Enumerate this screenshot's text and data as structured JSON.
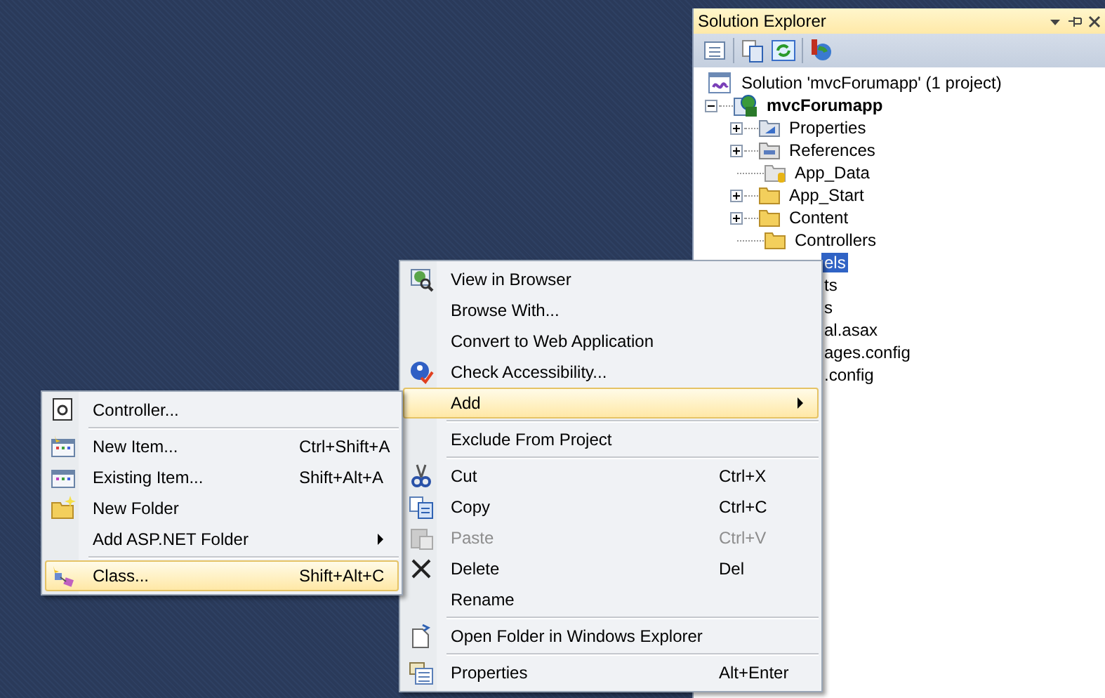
{
  "solution_explorer": {
    "title": "Solution Explorer",
    "tree": [
      {
        "label": "Solution 'mvcForumapp' (1 project)",
        "kind": "solution",
        "selected": false,
        "children": [
          {
            "label": "mvcForumapp",
            "kind": "project",
            "expanded": true,
            "selected": false,
            "children": [
              {
                "label": "Properties",
                "kind": "properties",
                "expanded": false,
                "selected": false
              },
              {
                "label": "References",
                "kind": "references",
                "expanded": false,
                "selected": false
              },
              {
                "label": "App_Data",
                "kind": "datafolder",
                "selected": false
              },
              {
                "label": "App_Start",
                "kind": "folder",
                "expanded": false,
                "selected": false
              },
              {
                "label": "Content",
                "kind": "folder",
                "expanded": false,
                "selected": false
              },
              {
                "label": "Controllers",
                "kind": "folder",
                "selected": false
              },
              {
                "label": "els",
                "kind": "cut",
                "selected": true
              },
              {
                "label": "ts",
                "kind": "cut",
                "selected": false
              },
              {
                "label": "s",
                "kind": "cut",
                "selected": false
              },
              {
                "label": "al.asax",
                "kind": "cut",
                "selected": false
              },
              {
                "label": "ages.config",
                "kind": "cut",
                "selected": false
              },
              {
                "label": ".config",
                "kind": "cut",
                "selected": false
              }
            ]
          }
        ]
      }
    ]
  },
  "context_menu": {
    "items": [
      {
        "kind": "item",
        "label": "View in Browser",
        "selected": false,
        "disabled": false
      },
      {
        "kind": "item",
        "label": "Browse With...",
        "selected": false,
        "disabled": false
      },
      {
        "kind": "item",
        "label": "Convert to Web Application",
        "selected": false,
        "disabled": false
      },
      {
        "kind": "item",
        "label": "Check Accessibility...",
        "selected": false,
        "disabled": false
      },
      {
        "kind": "submenu",
        "label": "Add",
        "selected": true,
        "disabled": false
      },
      {
        "kind": "separator"
      },
      {
        "kind": "item",
        "label": "Exclude From Project",
        "selected": false,
        "disabled": false
      },
      {
        "kind": "separator"
      },
      {
        "kind": "item",
        "label": "Cut",
        "shortcut": "Ctrl+X",
        "selected": false,
        "disabled": false
      },
      {
        "kind": "item",
        "label": "Copy",
        "shortcut": "Ctrl+C",
        "selected": false,
        "disabled": false
      },
      {
        "kind": "item",
        "label": "Paste",
        "shortcut": "Ctrl+V",
        "selected": false,
        "disabled": true
      },
      {
        "kind": "item",
        "label": "Delete",
        "shortcut": "Del",
        "selected": false,
        "disabled": false
      },
      {
        "kind": "item",
        "label": "Rename",
        "selected": false,
        "disabled": false
      },
      {
        "kind": "separator"
      },
      {
        "kind": "item",
        "label": "Open Folder in Windows Explorer",
        "selected": false,
        "disabled": false
      },
      {
        "kind": "separator"
      },
      {
        "kind": "item",
        "label": "Properties",
        "shortcut": "Alt+Enter",
        "selected": false,
        "disabled": false
      }
    ]
  },
  "add_submenu": {
    "items": [
      {
        "kind": "item",
        "label": "Controller...",
        "selected": false,
        "disabled": false
      },
      {
        "kind": "separator"
      },
      {
        "kind": "item",
        "label": "New Item...",
        "shortcut": "Ctrl+Shift+A",
        "selected": false,
        "disabled": false
      },
      {
        "kind": "item",
        "label": "Existing Item...",
        "shortcut": "Shift+Alt+A",
        "selected": false,
        "disabled": false
      },
      {
        "kind": "item",
        "label": "New Folder",
        "selected": false,
        "disabled": false
      },
      {
        "kind": "submenu",
        "label": "Add ASP.NET Folder",
        "selected": false,
        "disabled": false
      },
      {
        "kind": "separator"
      },
      {
        "kind": "item",
        "label": "Class...",
        "shortcut": "Shift+Alt+C",
        "selected": true,
        "disabled": false
      }
    ]
  }
}
